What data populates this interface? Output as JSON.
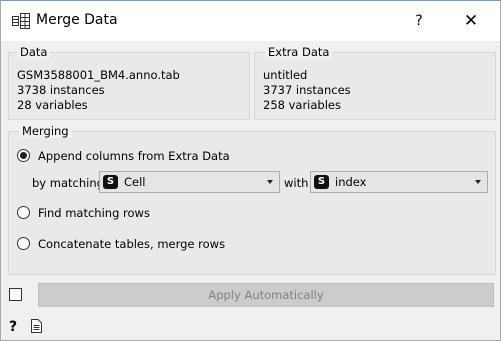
{
  "window": {
    "title": "Merge Data",
    "help_label": "?",
    "close_label": "✕",
    "icon": "merge-table-icon"
  },
  "data_box": {
    "title": "Data",
    "filename": "GSM3588001_BM4.anno.tab",
    "instances": "3738 instances",
    "variables": "28 variables"
  },
  "extra_box": {
    "title": "Extra Data",
    "filename": "untitled",
    "instances": "3737 instances",
    "variables": "258 variables"
  },
  "merging": {
    "title": "Merging",
    "options": [
      {
        "label": "Append columns from Extra Data",
        "checked": true
      },
      {
        "label": "Find matching rows",
        "checked": false
      },
      {
        "label": "Concatenate tables, merge rows",
        "checked": false
      }
    ],
    "by_matching_label": "by matching",
    "with_label": "with",
    "left_combo": {
      "badge": "S",
      "value": "Cell"
    },
    "right_combo": {
      "badge": "S",
      "value": "index"
    }
  },
  "footer": {
    "auto_apply_checked": false,
    "apply_label": "Apply Automatically",
    "help_icon": "question-icon",
    "report_icon": "document-icon"
  }
}
